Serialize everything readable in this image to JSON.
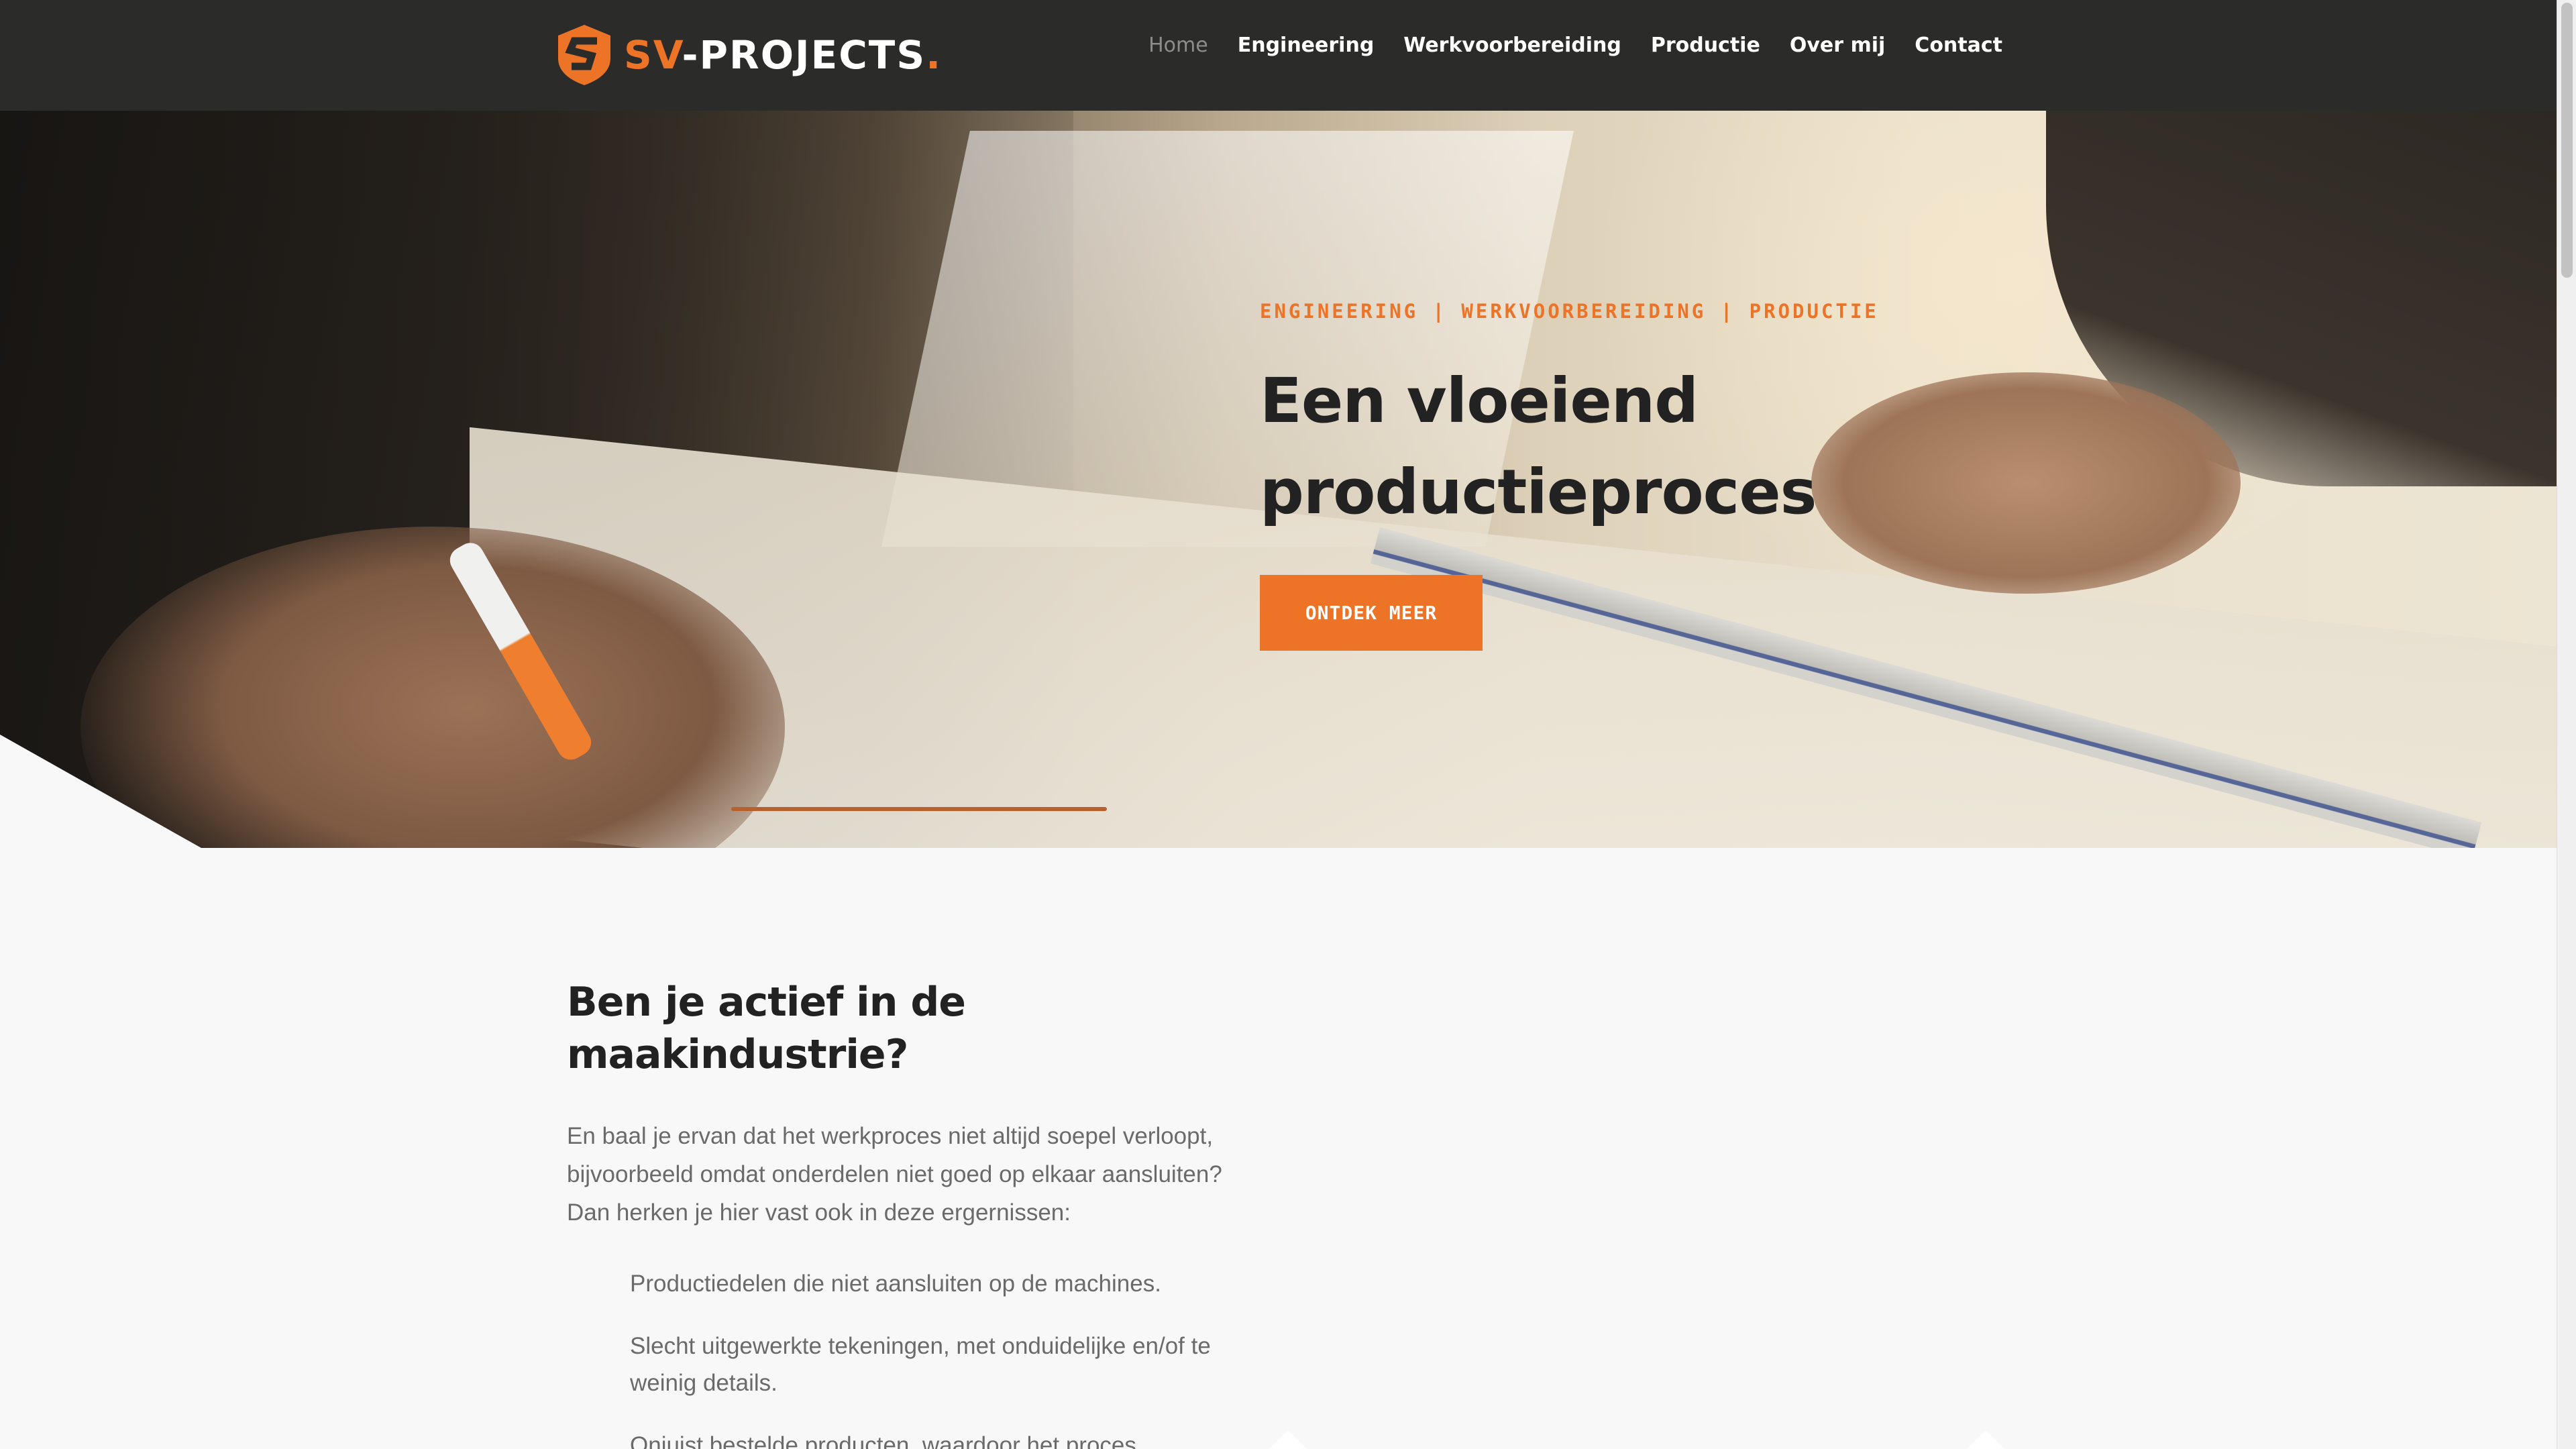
{
  "header": {
    "logo": {
      "part1": "SV",
      "part2": "-PROJECTS",
      "part3": ".",
      "icon": "shield-s-logo-icon"
    },
    "nav": [
      {
        "label": "Home",
        "active": true
      },
      {
        "label": "Engineering",
        "active": false
      },
      {
        "label": "Werkvoorbereiding",
        "active": false
      },
      {
        "label": "Productie",
        "active": false
      },
      {
        "label": "Over mij",
        "active": false
      },
      {
        "label": "Contact",
        "active": false
      }
    ]
  },
  "hero": {
    "tagline": "ENGINEERING | WERKVOORBEREIDING | PRODUCTIE",
    "title_line1": "Een vloeiend",
    "title_line2": "productieproces",
    "cta": "ONTDEK MEER",
    "background": "photo-engineer-drawing-with-pen-and-ruler"
  },
  "intro": {
    "title_line1": "Ben je actief in de",
    "title_line2": "maakindustrie?",
    "text": "En baal je ervan dat het werkproces niet altijd soepel verloopt, bijvoorbeeld omdat onderdelen niet goed op elkaar aansluiten? Dan herken je hier vast ook in deze ergernissen:",
    "issues": [
      "Productiedelen die niet aansluiten op de machines.",
      "Slecht uitgewerkte tekeningen, met onduidelijke en/of te weinig details.",
      "Onjuist bestelde producten, waardoor het proces"
    ]
  },
  "colors": {
    "accent": "#ed7326",
    "header_bg": "#2b2b2a",
    "page_bg": "#f8f8f8",
    "heading": "#222222",
    "body_text": "#6a6a6a"
  }
}
